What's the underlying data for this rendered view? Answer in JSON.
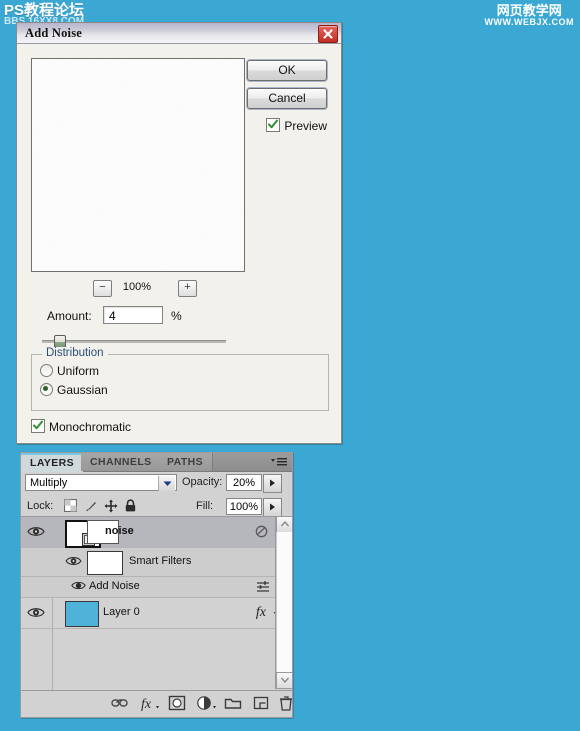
{
  "watermarks": {
    "left": {
      "main": "PS教程论坛",
      "sub": "BBS.16XX8.COM"
    },
    "right": {
      "main": "网页教学网",
      "sub": "WWW.WEBJX.COM"
    }
  },
  "dialog": {
    "title": "Add Noise",
    "close_icon": "close-x-icon",
    "zoom": {
      "minus": "−",
      "level": "100%",
      "plus": "+"
    },
    "amount": {
      "label": "Amount:",
      "value": "4",
      "unit": "%"
    },
    "distribution": {
      "legend": "Distribution",
      "options": [
        {
          "label": "Uniform",
          "selected": false
        },
        {
          "label": "Gaussian",
          "selected": true
        }
      ]
    },
    "monochromatic": {
      "label": "Monochromatic",
      "checked": true
    },
    "buttons": {
      "ok": "OK",
      "cancel": "Cancel"
    },
    "preview": {
      "label": "Preview",
      "checked": true
    }
  },
  "panel": {
    "tabs": [
      {
        "label": "LAYERS",
        "active": true
      },
      {
        "label": "CHANNELS",
        "active": false
      },
      {
        "label": "PATHS",
        "active": false
      }
    ],
    "menu_icon": "panel-menu-icon",
    "blend_mode": "Multiply",
    "opacity": {
      "label": "Opacity:",
      "value": "20%"
    },
    "lock": {
      "label": "Lock:",
      "icons": [
        "lock-transparency-icon",
        "lock-image-icon",
        "lock-position-icon",
        "lock-all-icon"
      ]
    },
    "fill": {
      "label": "Fill:",
      "value": "100%"
    },
    "layers": [
      {
        "name": "noise",
        "type": "smart-object",
        "visible": true,
        "selected": true,
        "has_mask": true,
        "right_icons": [
          "smart-object-badge-icon",
          "collapse-triangle-icon"
        ]
      },
      {
        "name": "Smart Filters",
        "type": "smart-filters",
        "visible": true,
        "selected": false
      },
      {
        "name": "Add Noise",
        "type": "filter",
        "visible": true,
        "selected": false,
        "right_icons": [
          "filter-settings-icon"
        ]
      },
      {
        "name": "Layer 0",
        "type": "layer",
        "visible": true,
        "selected": false,
        "thumb_color": "#4fb3d9",
        "right_icons": [
          "fx-icon",
          "expand-triangle-icon"
        ]
      }
    ],
    "footer_buttons": [
      "link-layers-icon",
      "layer-style-fx-icon",
      "add-layer-mask-icon",
      "adjustment-layer-icon",
      "new-group-icon",
      "new-layer-icon",
      "delete-layer-icon"
    ]
  },
  "colors": {
    "background": "#3ba8d4",
    "layer0_thumb": "#4fb3d9",
    "close_button": "#c12c22"
  }
}
